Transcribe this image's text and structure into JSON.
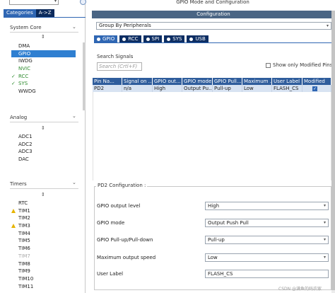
{
  "left_panel": {
    "search_value": "",
    "tabs": [
      {
        "label": "Categories",
        "active": true
      },
      {
        "label": "A->Z",
        "active": false
      }
    ],
    "sections": [
      {
        "title": "System Core",
        "items": [
          {
            "label": "DMA",
            "state": "normal"
          },
          {
            "label": "GPIO",
            "state": "selected"
          },
          {
            "label": "IWDG",
            "state": "normal"
          },
          {
            "label": "NVIC",
            "state": "green"
          },
          {
            "label": "RCC",
            "state": "check"
          },
          {
            "label": "SYS",
            "state": "check"
          },
          {
            "label": "WWDG",
            "state": "normal"
          }
        ]
      },
      {
        "title": "Analog",
        "items": [
          {
            "label": "ADC1",
            "state": "normal"
          },
          {
            "label": "ADC2",
            "state": "normal"
          },
          {
            "label": "ADC3",
            "state": "normal"
          },
          {
            "label": "DAC",
            "state": "normal"
          }
        ]
      },
      {
        "title": "Timers",
        "items": [
          {
            "label": "RTC",
            "state": "normal"
          },
          {
            "label": "TIM1",
            "state": "warning"
          },
          {
            "label": "TIM2",
            "state": "normal"
          },
          {
            "label": "TIM3",
            "state": "warning"
          },
          {
            "label": "TIM4",
            "state": "normal"
          },
          {
            "label": "TIM5",
            "state": "normal"
          },
          {
            "label": "TIM6",
            "state": "normal"
          },
          {
            "label": "TIM7",
            "state": "gray"
          },
          {
            "label": "TIM8",
            "state": "normal"
          },
          {
            "label": "TIM9",
            "state": "normal"
          },
          {
            "label": "TIM10",
            "state": "normal"
          },
          {
            "label": "TIM11",
            "state": "normal"
          }
        ]
      }
    ]
  },
  "main": {
    "title": "GPIO Mode and Configuration",
    "config_header": "Configuration",
    "group_by": "Group By Peripherals",
    "tabs": [
      {
        "label": "GPIO",
        "active": true
      },
      {
        "label": "RCC",
        "active": false
      },
      {
        "label": "SPI",
        "active": false
      },
      {
        "label": "SYS",
        "active": false
      },
      {
        "label": "USB",
        "active": false
      }
    ],
    "search_label": "Search Signals",
    "search_placeholder": "Search (Crtl+F)",
    "show_modified_label": "Show only Modified Pins",
    "table": {
      "columns": [
        "Pin Na...",
        "Signal on ...",
        "GPIO out...",
        "GPIO mode",
        "GPIO Pull...",
        "Maximum ...",
        "User Label",
        "Modified"
      ],
      "rows": [
        [
          "PD2",
          "n/a",
          "High",
          "Output Pu...",
          "Pull-up",
          "Low",
          "FLASH_CS",
          "checked"
        ]
      ]
    },
    "pin_config": {
      "title": "PD2 Configuration :",
      "fields": [
        {
          "label": "GPIO output level",
          "value": "High",
          "type": "select"
        },
        {
          "label": "GPIO mode",
          "value": "Output Push Pull",
          "type": "select"
        },
        {
          "label": "GPIO Pull-up/Pull-down",
          "value": "Pull-up",
          "type": "select"
        },
        {
          "label": "Maximum output speed",
          "value": "Low",
          "type": "select"
        },
        {
          "label": "User Label",
          "value": "FLASH_CS",
          "type": "text"
        }
      ]
    }
  },
  "watermark": "CSDN @满鱼的码农家",
  "colors": {
    "accent": "#2f66b3",
    "dark_tab": "#0d2e63",
    "header_bar": "#4a6584",
    "selection": "#2f7fd1",
    "warning": "#e6b400",
    "ok_green": "#2e8b2e"
  }
}
